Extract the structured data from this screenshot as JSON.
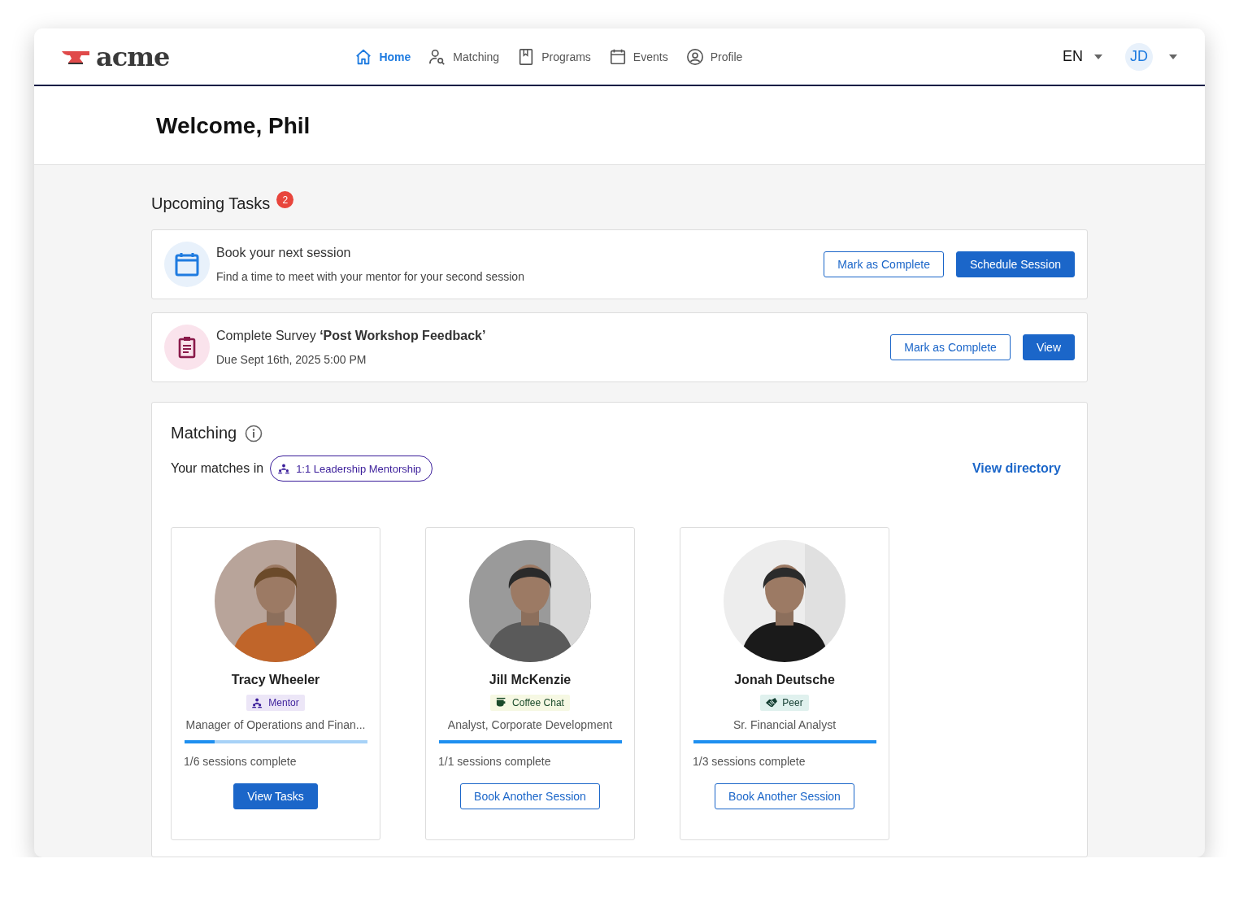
{
  "header": {
    "logo": "acme",
    "nav": [
      {
        "label": "Home",
        "kind": "home",
        "selected": true
      },
      {
        "label": "Matching",
        "kind": "matching",
        "selected": false
      },
      {
        "label": "Programs",
        "kind": "programs",
        "selected": false
      },
      {
        "label": "Events",
        "kind": "events",
        "selected": false
      },
      {
        "label": "Profile",
        "kind": "profile",
        "selected": false
      }
    ],
    "language": "EN",
    "avatar": "JD"
  },
  "welcome": "Welcome, Phil",
  "tasks": {
    "title": "Upcoming Tasks",
    "count": "2",
    "items": [
      {
        "kind": "session",
        "title": "Book your next session",
        "subtitle": "Find a time to meet with your mentor for your second session",
        "buttons": [
          {
            "label": "Mark as Complete",
            "kind": "outline"
          },
          {
            "label": "Schedule Session",
            "kind": "primary"
          }
        ]
      },
      {
        "kind": "survey",
        "title": "Complete Survey **‘Post Workshop Feedback’**",
        "subtitle": "Due Sept 16th, 2025 5:00 PM",
        "buttons": [
          {
            "label": "Mark as Complete",
            "kind": "outline"
          },
          {
            "label": "View",
            "kind": "primary"
          }
        ]
      }
    ]
  },
  "matching": {
    "title": "Matching",
    "matches_label": "Your matches in",
    "program": "1:1 Leadership Mentorship",
    "view_directory": "View directory",
    "matches": [
      {
        "name": "Tracy Wheeler",
        "tag": {
          "label": "Mentor",
          "kind": "mentor"
        },
        "role": "Manager of Operations and Finan...",
        "level": 0.167,
        "sessions": "1/6 sessions complete",
        "button": {
          "label": "View Tasks",
          "kind": "primary"
        }
      },
      {
        "name": "Jill McKenzie",
        "tag": {
          "label": "Coffee Chat",
          "kind": "coffee"
        },
        "role": "Analyst, Corporate Development",
        "level": 1,
        "sessions": "1/1 sessions complete",
        "button": {
          "label": "Book Another Session",
          "kind": "outline"
        }
      },
      {
        "name": "Jonah Deutsche",
        "tag": {
          "label": "Peer",
          "kind": "peer"
        },
        "role": "Sr. Financial Analyst",
        "level": 1,
        "sessions": "1/3 sessions complete",
        "button": {
          "label": "Book Another Session",
          "kind": "outline"
        }
      }
    ]
  }
}
